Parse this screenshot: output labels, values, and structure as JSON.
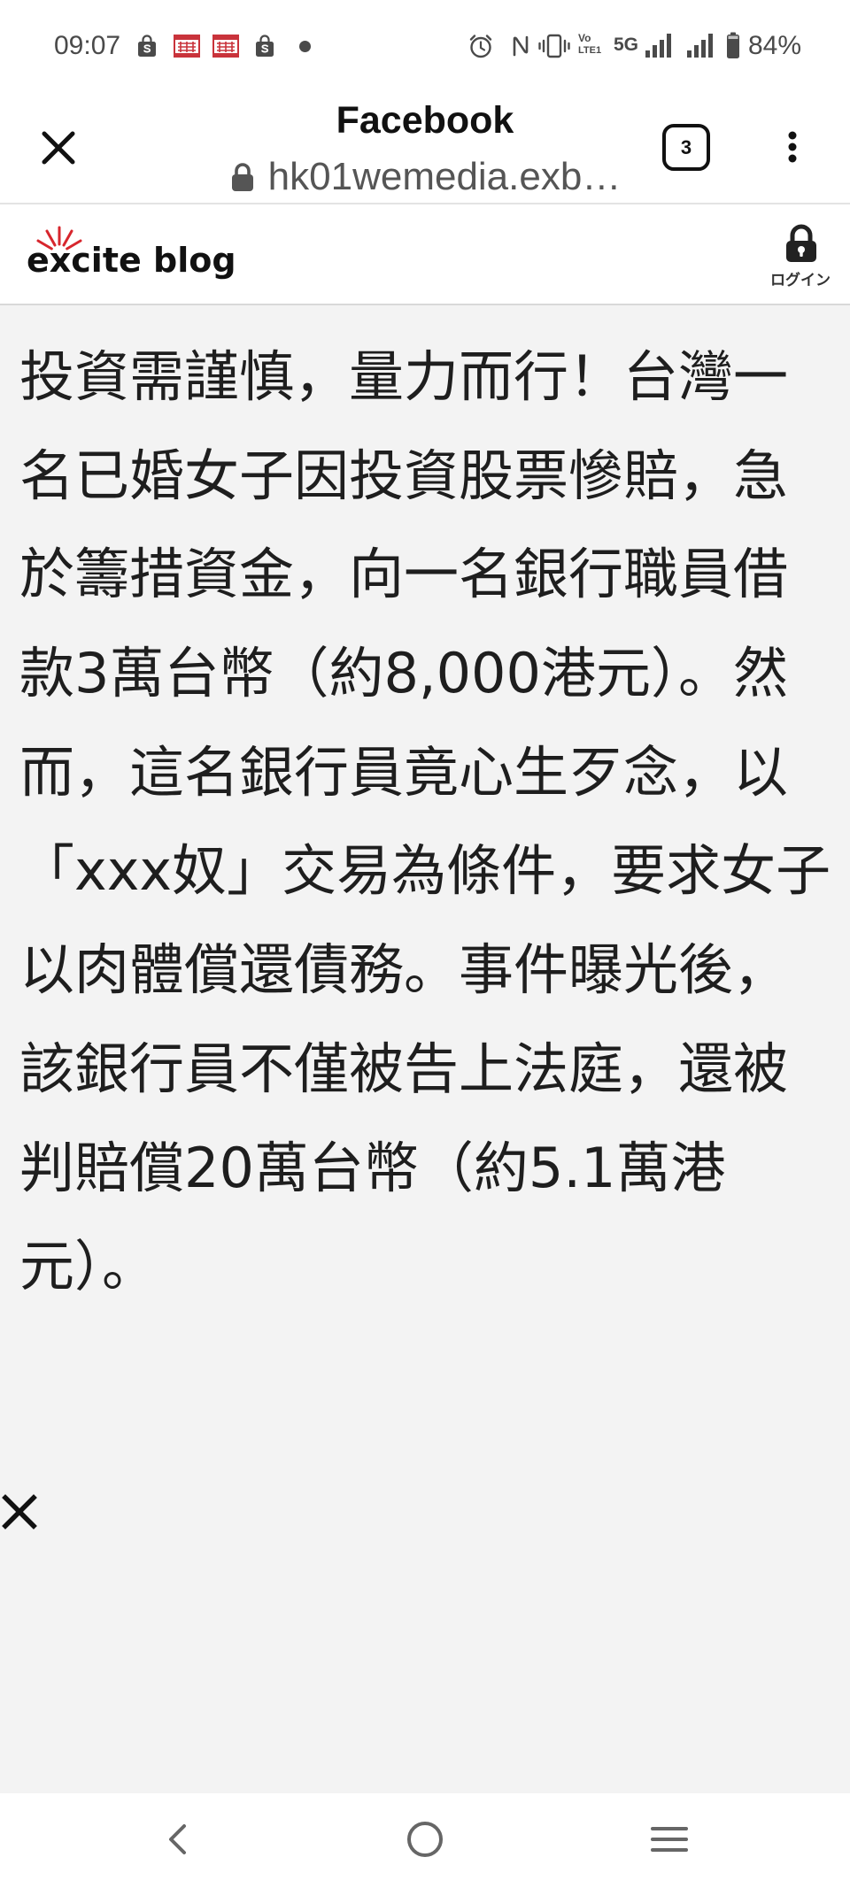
{
  "status_bar": {
    "time": "09:07",
    "left_icons": [
      "shopping-bag-icon",
      "red-app-icon",
      "red-app-icon",
      "shopping-bag-icon",
      "notification-dot-icon"
    ],
    "right_icons": [
      "alarm-icon",
      "nfc-icon",
      "vibrate-icon",
      "volte-icon",
      "network-type",
      "signal-icon",
      "signal-icon",
      "battery-icon"
    ],
    "volte_top": "Vo",
    "volte_bottom": "LTE1",
    "network": "5G",
    "battery_percent": "84%"
  },
  "browser": {
    "close_icon": "close-icon",
    "title": "Facebook",
    "url_icon": "lock-icon",
    "url": "hk01wemedia.exb…",
    "tab_count": "3",
    "menu_icon": "more-vertical-icon"
  },
  "site_header": {
    "logo_text": "excite blog",
    "login_icon": "lock-icon",
    "login_label": "ログイン"
  },
  "article": {
    "lines": [
      "投資需謹慎，量力而行！台灣一",
      "名已婚女子因投資股票慘賠，急",
      "於籌措資金，向一名銀行職員借",
      "款3萬台幣（約8,000港元）。然",
      "而，這名銀行員竟心生歹念，以",
      "「xxx奴」交易為條件，要求女子",
      "以肉體償還債務。事件曝光後，",
      "該銀行員不僅被告上法庭，還被",
      "判賠償20萬台幣（約5.1萬港",
      "元）。"
    ]
  },
  "overlay": {
    "close_icon": "close-icon"
  },
  "nav_bar": {
    "icons": [
      "back-icon",
      "home-icon",
      "recents-icon"
    ]
  },
  "colors": {
    "content_background": "#f3f3f3",
    "text": "#1e1e1e",
    "logo_accent": "#d7262d",
    "status_icon": "#4a4a4a",
    "nav_icon": "#666666",
    "app_red": "#c9333b"
  }
}
